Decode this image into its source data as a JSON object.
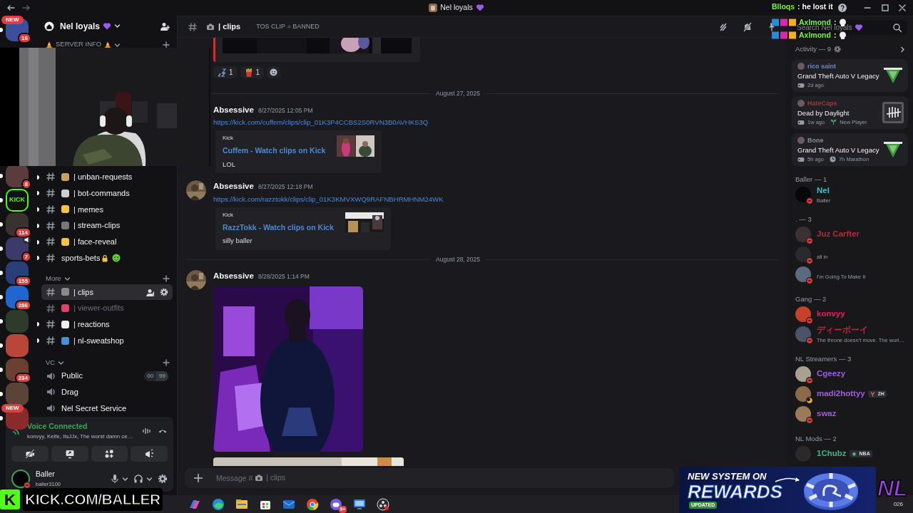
{
  "titlebar": {
    "title": "Nel loyals"
  },
  "stream_chat": [
    {
      "user": "Blloqs",
      "text": ": he lost it",
      "badges": false
    },
    {
      "user": "Axlmond",
      "text": ":",
      "badges": true
    },
    {
      "user": "Axlmond",
      "text": ":",
      "badges": true
    }
  ],
  "servers": [
    {
      "kind": "avatar",
      "color": "#3b4f9c",
      "unread": true,
      "voice": false,
      "badge": "16",
      "pill": "NEW"
    },
    {
      "kind": "avatar",
      "color": "#5a3c3c",
      "unread": true,
      "voice": false,
      "badge": "8"
    },
    {
      "kind": "logo",
      "label": "KICK",
      "color": "#53fc18",
      "unread": true,
      "voice": false
    },
    {
      "kind": "avatar",
      "color": "#3a3230",
      "unread": true,
      "voice": false,
      "badge": "114"
    },
    {
      "kind": "avatar",
      "color": "#3b3a6a",
      "unread": true,
      "voice": true,
      "badge": "7"
    },
    {
      "kind": "avatar",
      "color": "#2a3f7a",
      "unread": true,
      "voice": false,
      "badge": "155"
    },
    {
      "kind": "avatar",
      "color": "#1e66d0",
      "unread": true,
      "voice": false,
      "badge": "286"
    },
    {
      "kind": "avatar",
      "color": "#2e3a2a",
      "unread": true,
      "voice": false
    },
    {
      "kind": "avatar",
      "color": "#b8463a",
      "unread": true,
      "voice": false
    },
    {
      "kind": "avatar",
      "color": "#6a4030",
      "unread": true,
      "voice": false,
      "badge": "234"
    },
    {
      "kind": "avatar",
      "color": "#5a4438",
      "unread": true,
      "voice": false
    },
    {
      "kind": "avatar",
      "color": "#8a2a2a",
      "unread": true,
      "voice": false,
      "pill": "NEW"
    }
  ],
  "sidebar": {
    "server_name": "Nel loyals",
    "categories": [
      {
        "name": "SERVER INFO",
        "channels": [
          {
            "kind": "text",
            "name": "| unban-requests",
            "color": "#c8a060",
            "unread": true,
            "selected": false,
            "muted": false
          },
          {
            "kind": "text",
            "name": "| bot-commands",
            "color": "#d0d0d0",
            "unread": true,
            "selected": false,
            "muted": false
          },
          {
            "kind": "text",
            "name": "| memes",
            "color": "#f5c242",
            "unread": true,
            "selected": false,
            "muted": false
          },
          {
            "kind": "text",
            "name": "| stream-clips",
            "color": "#777777",
            "unread": true,
            "selected": false,
            "muted": false
          },
          {
            "kind": "text",
            "name": "| face-reveal",
            "color": "#f5c242",
            "unread": true,
            "selected": false,
            "muted": false
          },
          {
            "kind": "text-suffix",
            "name": "sports-bets",
            "unread": true,
            "selected": false,
            "muted": false
          }
        ]
      },
      {
        "name": "More",
        "channels": [
          {
            "kind": "text",
            "name": "| clips",
            "color": "#8a8a8a",
            "unread": false,
            "selected": true,
            "muted": false
          },
          {
            "kind": "text",
            "name": "| viewer-outfits",
            "color": "#e0406a",
            "unread": false,
            "selected": false,
            "muted": true
          },
          {
            "kind": "text",
            "name": "| reactions",
            "color": "#eeeeee",
            "unread": true,
            "selected": false,
            "muted": false
          },
          {
            "kind": "text",
            "name": "| nl-sweatshop",
            "color": "#4a90d9",
            "unread": true,
            "selected": false,
            "muted": false
          }
        ]
      },
      {
        "name": "VC",
        "channels": [
          {
            "kind": "voice",
            "name": "Public",
            "counts": [
              "00",
              "99"
            ],
            "selected": false,
            "muted": false
          },
          {
            "kind": "voice",
            "name": "Drag",
            "selected": false,
            "muted": false
          },
          {
            "kind": "voice",
            "name": "Nel Secret Service",
            "selected": false,
            "muted": false
          }
        ]
      }
    ]
  },
  "voice": {
    "status": "Voice Connected",
    "members": "konvyy, Keife, ItsJJx, The worst damn ce…"
  },
  "user": {
    "name": "Baller",
    "tag": "baller3100",
    "do_not_disturb": true
  },
  "channel_header": {
    "name": "| clips",
    "topic": "TOS CLIP = BANNED"
  },
  "messages": [
    {
      "kind": "embed-tail",
      "reactions": [
        {
          "count": "1"
        },
        {
          "count": "1"
        }
      ]
    },
    {
      "kind": "divider",
      "text": "August 27, 2025"
    },
    {
      "kind": "message",
      "author": "Absessive",
      "time": "8/27/2025 12:05 PM",
      "link": "https://kick.com/cuffem/clips/clip_01K3P4CCBS2S0RVN3B0AVHKS3Q",
      "embed": {
        "provider": "Kick",
        "title": "Cuffem - Watch clips on Kick",
        "description": "LOL"
      }
    },
    {
      "kind": "message",
      "avatar": true,
      "author": "Absessive",
      "time": "8/27/2025 12:18 PM",
      "link": "https://kick.com/razztokk/clips/clip_01K3KMVXWQ9RAFNBHRMHNM24WK",
      "embed": {
        "provider": "Kick",
        "title": "RazzTokk - Watch clips on Kick",
        "description": "silly baller"
      }
    },
    {
      "kind": "divider",
      "text": "August 28, 2025"
    },
    {
      "kind": "image-message",
      "avatar": true,
      "author": "Absessive",
      "time": "8/28/2025 1:14 PM"
    },
    {
      "kind": "image-tail"
    }
  ],
  "composer": {
    "placeholder": "Message #",
    "placeholder_after": "| clips"
  },
  "members": {
    "search": {
      "placeholder": "Search Nel loyals"
    },
    "activity": {
      "title": "Activity — 9",
      "cards": [
        {
          "kind": "gta",
          "user": "rico saint",
          "color": "#5b8ed6",
          "game": "Grand Theft Auto V Legacy",
          "time": "2d ago"
        },
        {
          "kind": "dbd",
          "user": "HateCaps",
          "color": "#a8323c",
          "game": "Dead by Daylight",
          "time": "1w ago",
          "extra": "New Player"
        },
        {
          "kind": "gta",
          "user": "Bone",
          "color": "#8a8d92",
          "game": "Grand Theft Auto V Legacy",
          "time": "5h ago",
          "extra": "7h Marathon"
        }
      ]
    },
    "groups": [
      {
        "title": "Baller — 1",
        "members": [
          {
            "kind": "dnd",
            "name": "Nel",
            "color": "#3fc1c9",
            "status": "Baller"
          }
        ]
      },
      {
        "title": ". — 3",
        "members": [
          {
            "kind": "dnd",
            "name": "Juz Carfter",
            "color": "#a8323c"
          },
          {
            "kind": "dnd",
            "status": "all in"
          },
          {
            "kind": "dnd",
            "status": "I'm Going To Make It"
          }
        ]
      },
      {
        "title": "Gang — 2",
        "members": [
          {
            "kind": "dnd",
            "name": "konvyy",
            "color": "#e0245e"
          },
          {
            "kind": "dnd",
            "name": "ディーボーイ",
            "color": "#c8203f",
            "status": "The throne doesn't move. The worl…"
          }
        ]
      },
      {
        "title": "NL Streamers — 3",
        "members": [
          {
            "kind": "dnd",
            "name": "Cgeezy",
            "color": "#a35de0"
          },
          {
            "kind": "idle",
            "name": "madi2hottyy",
            "color": "#a35de0",
            "tag": "2H"
          },
          {
            "kind": "dnd",
            "name": "swaz",
            "color": "#a35de0"
          }
        ]
      },
      {
        "title": "NL Mods — 2",
        "members": [
          {
            "kind": "none",
            "name": "1Chubz",
            "color": "#43b581",
            "tag": "NBA"
          }
        ]
      }
    ]
  },
  "taskbar": {
    "badge": "9+",
    "clock": "026"
  },
  "kick_banner": {
    "logo": "K",
    "text": "KICK.COM/BALLER"
  },
  "rewards_banner": {
    "line1": "NEW SYSTEM ON",
    "line2": "REWARDS",
    "tag": "UPDATED",
    "logo": "NL"
  }
}
